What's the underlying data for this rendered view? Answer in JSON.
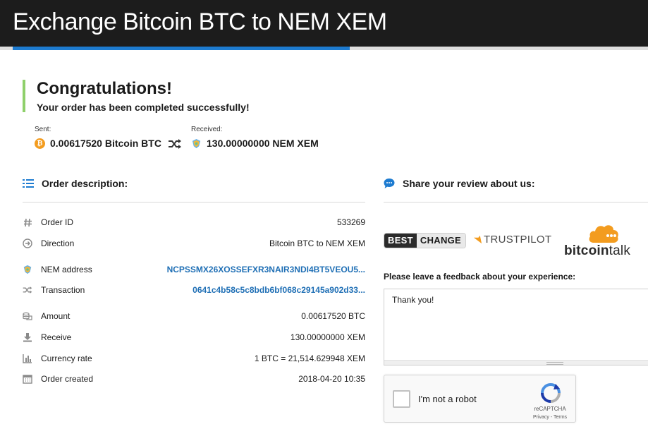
{
  "header": {
    "title": "Exchange Bitcoin BTC to NEM XEM"
  },
  "status": {
    "title": "Congratulations!",
    "message": "Your order has been completed successfully!"
  },
  "transfer": {
    "sent_label": "Sent:",
    "sent_value": "0.00617520 Bitcoin BTC",
    "received_label": "Received:",
    "received_value": "130.00000000 NEM XEM"
  },
  "order": {
    "heading": "Order description:",
    "rows": [
      {
        "label": "Order ID",
        "value": "533269",
        "icon": "hash-icon"
      },
      {
        "label": "Direction",
        "value": "Bitcoin BTC to NEM XEM",
        "icon": "direction-arrow-icon"
      },
      {
        "label": "NEM address",
        "value": "NCPSSMX26XOSSEFXR3NAIR3NDI4BT5VEOU5...",
        "icon": "nem-icon"
      },
      {
        "label": "Transaction",
        "value": "0641c4b58c5c8bdb6bf068c29145a902d33...",
        "icon": "shuffle-icon"
      },
      {
        "label": "Amount",
        "value": "0.00617520 BTC",
        "icon": "coins-icon"
      },
      {
        "label": "Receive",
        "value": "130.00000000 XEM",
        "icon": "download-icon"
      },
      {
        "label": "Currency rate",
        "value": "1 BTC = 21,514.629948 XEM",
        "icon": "bar-chart-icon"
      },
      {
        "label": "Order created",
        "value": "2018-04-20 10:35",
        "icon": "calendar-icon"
      }
    ]
  },
  "review": {
    "heading": "Share your review about us:",
    "logos": {
      "bestchange_left": "BEST",
      "bestchange_right": "CHANGE",
      "trustpilot": "TRUSTPILOT",
      "bitcointalk_bold": "bitcoin",
      "bitcointalk_rest": "talk"
    },
    "feedback_label": "Please leave a feedback about your experience:",
    "feedback_value": "Thank you!"
  },
  "captcha": {
    "label": "I'm not a robot",
    "brand": "reCAPTCHA",
    "terms": "Privacy - Terms"
  },
  "colors": {
    "header_bg": "#1c1c1c",
    "accent": "#1d7bd0",
    "success": "#8fd06b",
    "link": "#1f6fb5",
    "btc": "#f39c1f"
  }
}
